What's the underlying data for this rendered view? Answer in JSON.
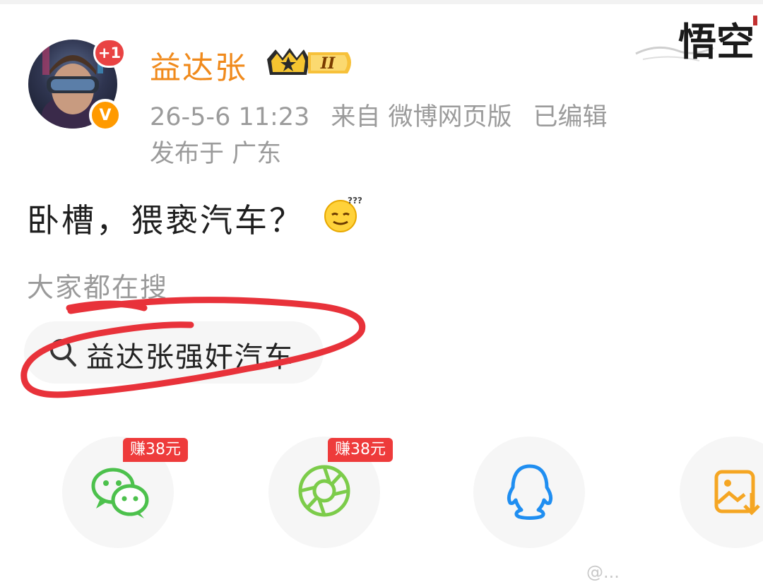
{
  "post": {
    "username": "益达张",
    "vip_level": "II",
    "avatar_badge": "+1",
    "verified_mark": "V",
    "meta": {
      "time": "26-5-6 11:23",
      "source": "来自 微博网页版",
      "edited": "已编辑",
      "location": "发布于 广东"
    },
    "text": "卧槽，猥亵汽车？",
    "emoji": "thinking-emoji"
  },
  "search": {
    "title": "大家都在搜",
    "query": "益达张强奸汽车"
  },
  "share": {
    "items": [
      {
        "name": "wechat",
        "icon": "wechat-icon",
        "badge": "赚38元"
      },
      {
        "name": "moments",
        "icon": "moments-icon",
        "badge": "赚38元"
      },
      {
        "name": "qq",
        "icon": "qq-icon",
        "badge": ""
      },
      {
        "name": "save-image",
        "icon": "save-image-icon",
        "badge": ""
      }
    ]
  },
  "decor": {
    "calligraphy_text": "悟空",
    "watermark": "@..."
  },
  "colors": {
    "username": "#f08a1c",
    "meta": "#9b9b9b",
    "badge_red": "#ee3b3b",
    "annotation_red": "#e8323a",
    "wechat_green": "#4cc14c",
    "qq_blue": "#1f8ef1",
    "save_orange": "#f5a623"
  }
}
